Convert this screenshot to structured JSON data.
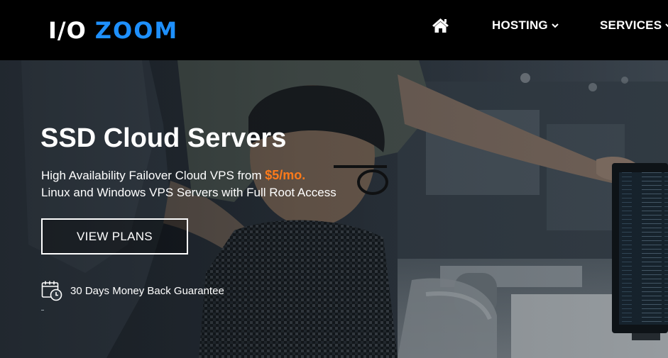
{
  "brand": {
    "io": "I/O",
    "zoom": "ZOOM"
  },
  "nav": {
    "home_icon": "home-icon",
    "items": [
      {
        "label": "HOSTING",
        "icon": "chevron-down-icon"
      },
      {
        "label": "SERVICES",
        "icon": "chevron-down-icon"
      }
    ]
  },
  "hero": {
    "title": "SSD Cloud Servers",
    "line1_prefix": "High Availability Failover Cloud VPS from ",
    "price": "$5/mo.",
    "line2": "Linux and Windows VPS Servers with Full Root Access",
    "button_label": "VIEW PLANS",
    "guarantee_icon": "calendar-clock-icon",
    "guarantee_text": "30 Days Money Back Guarantee"
  },
  "colors": {
    "nav_background": "#000000",
    "brand_accent": "#1e90ff",
    "price_accent": "#ff7a1a",
    "text": "#ffffff"
  }
}
